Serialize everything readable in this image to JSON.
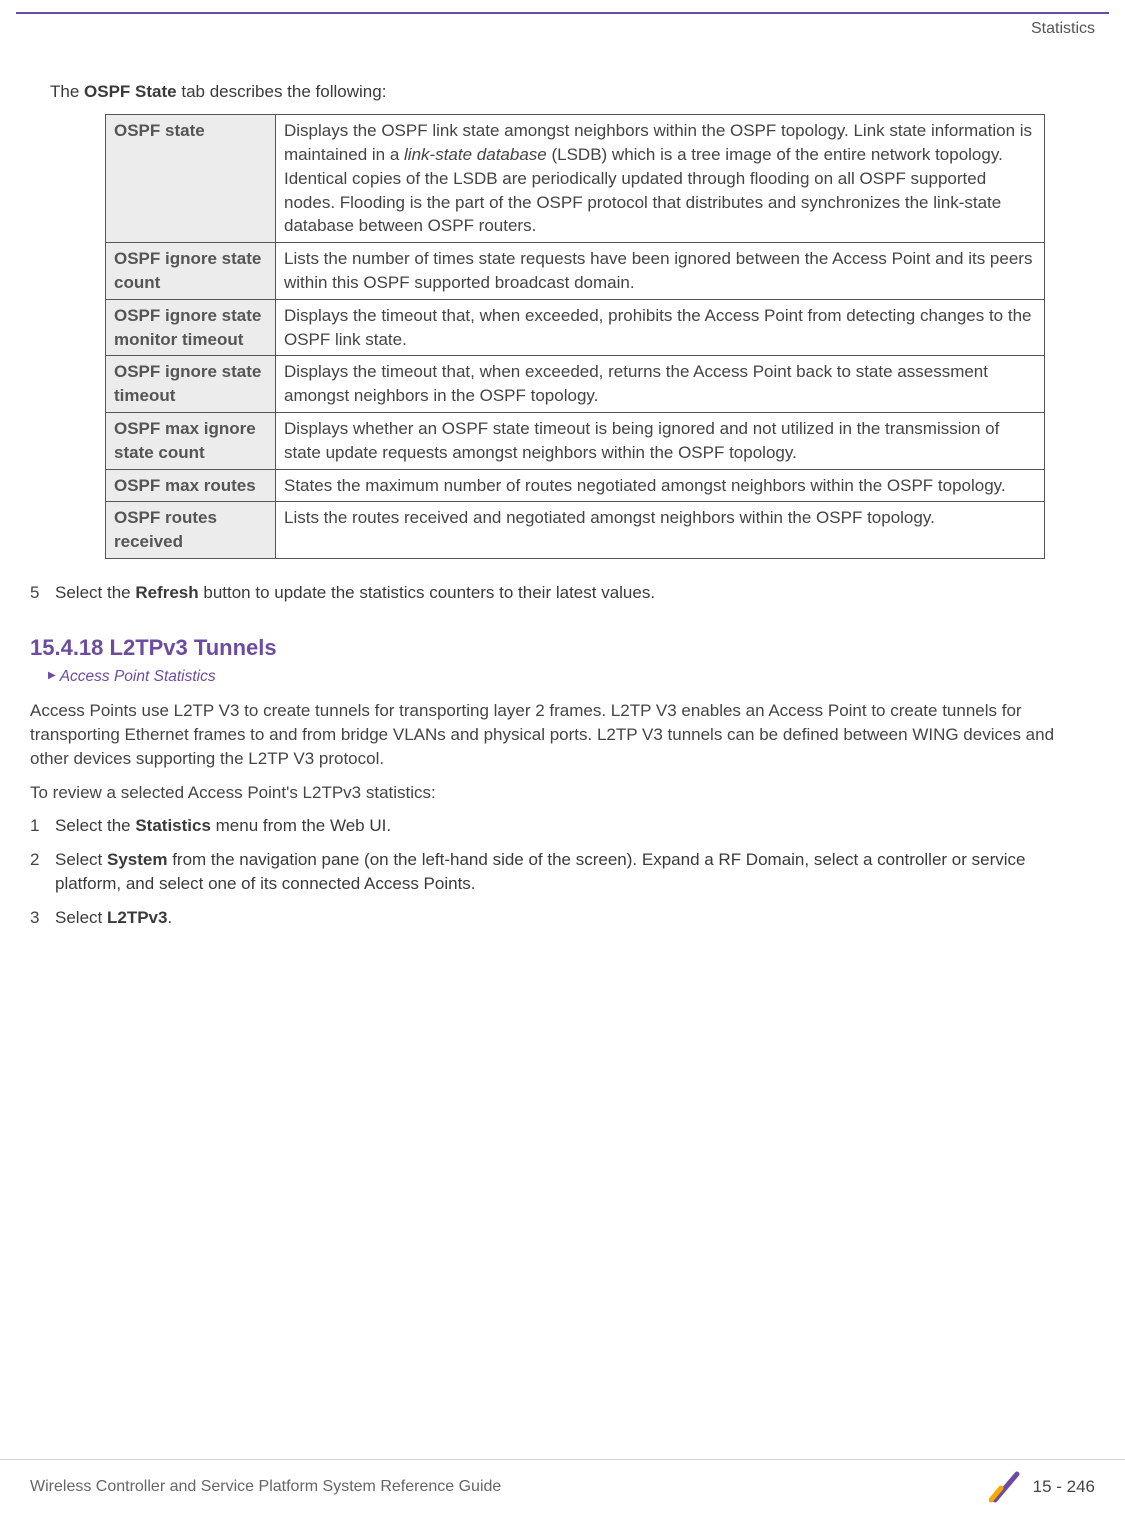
{
  "header": {
    "breadcrumb": "Statistics"
  },
  "intro": {
    "prefix": "The ",
    "bold": "OSPF State",
    "suffix": " tab describes the following:"
  },
  "table": {
    "rows": [
      {
        "label": "OSPF state",
        "desc_before": "Displays the OSPF link state amongst neighbors within the OSPF topology. Link state information is maintained in a ",
        "desc_italic": "link-state database",
        "desc_after": " (LSDB) which is a tree image of the entire network topology. Identical copies of the LSDB are periodically updated through flooding on all OSPF supported nodes. Flooding is the part of the OSPF protocol that distributes and synchronizes the link-state database between OSPF routers."
      },
      {
        "label": "OSPF ignore state count",
        "desc": "Lists the number of times state requests have been ignored between the Access Point and its peers within this OSPF supported broadcast domain."
      },
      {
        "label": "OSPF ignore state monitor timeout",
        "desc": "Displays the timeout that, when exceeded, prohibits the Access Point from detecting changes to the OSPF link state."
      },
      {
        "label": "OSPF ignore state timeout",
        "desc": "Displays the timeout that, when exceeded, returns the Access Point back to state assessment amongst neighbors in the OSPF topology."
      },
      {
        "label": "OSPF max ignore state count",
        "desc": "Displays whether an OSPF state timeout is being ignored and not utilized in the transmission of state update requests amongst neighbors within the OSPF topology."
      },
      {
        "label": "OSPF max routes",
        "desc": "States the maximum number of routes negotiated amongst neighbors within the OSPF topology."
      },
      {
        "label": "OSPF routes received",
        "desc": "Lists the routes received and negotiated amongst neighbors within the OSPF topology."
      }
    ]
  },
  "step5": {
    "num": "5",
    "prefix": "Select the ",
    "bold": "Refresh",
    "suffix": " button to update the statistics counters to their latest values."
  },
  "section": {
    "heading": "15.4.18  L2TPv3 Tunnels",
    "crumb": "Access Point Statistics"
  },
  "para1": "Access Points use L2TP V3 to create tunnels for transporting layer 2 frames. L2TP V3 enables an Access Point to create tunnels for transporting Ethernet frames to and from bridge VLANs and physical ports. L2TP V3 tunnels can be defined between WING devices and other devices supporting the L2TP V3 protocol.",
  "para2": "To review a selected Access Point's L2TPv3 statistics:",
  "steps": [
    {
      "num": "1",
      "prefix": "Select the ",
      "bold": "Statistics",
      "suffix": " menu from the Web UI."
    },
    {
      "num": "2",
      "prefix": "Select ",
      "bold": "System",
      "suffix": " from the navigation pane (on the left-hand side of the screen). Expand a RF Domain, select a controller or service platform, and select one of its connected Access Points."
    },
    {
      "num": "3",
      "prefix": "Select ",
      "bold": "L2TPv3",
      "suffix": "."
    }
  ],
  "footer": {
    "left": "Wireless Controller and Service Platform System Reference Guide",
    "page": "15 - 246"
  }
}
